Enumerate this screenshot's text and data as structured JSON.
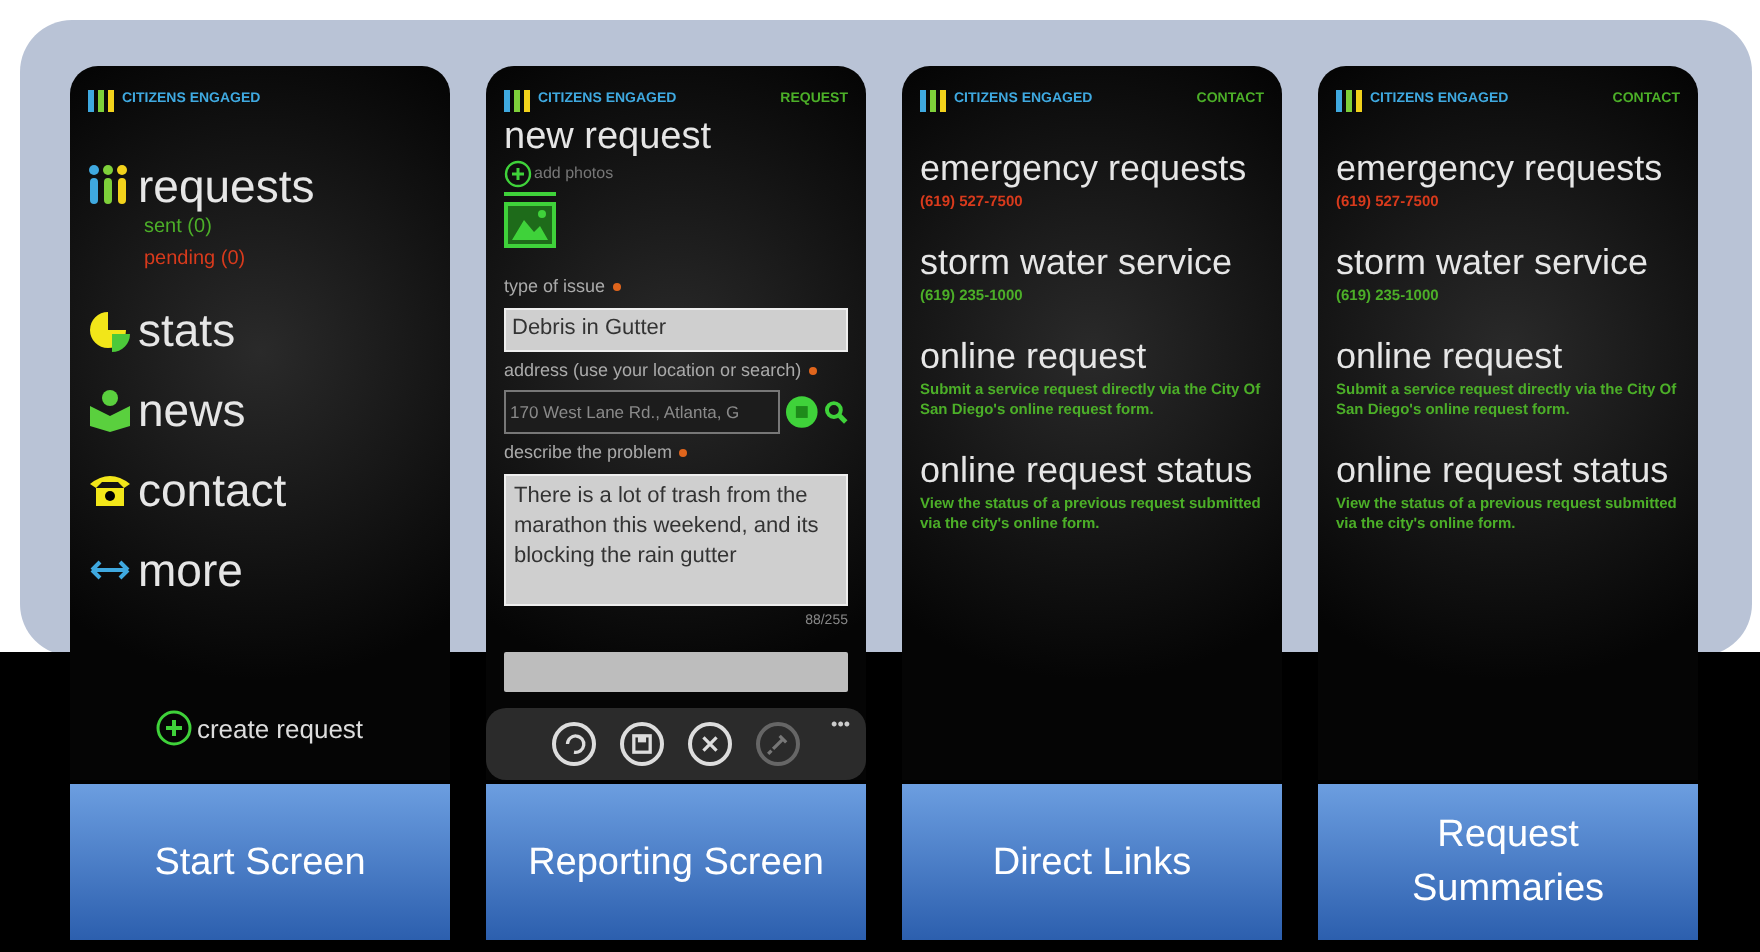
{
  "screens": [
    {
      "kind": "home",
      "brand": "CITIZENS ENGAGED",
      "caption": "Start Screen",
      "menu": [
        {
          "label": "requests",
          "sub": [
            {
              "label": "sent (0)",
              "color": "#4caf28"
            },
            {
              "label": "pending (0)",
              "color": "#d83a1c"
            }
          ]
        },
        {
          "label": "stats"
        },
        {
          "label": "news"
        },
        {
          "label": "contact"
        },
        {
          "label": "more"
        }
      ],
      "create": "create request"
    },
    {
      "kind": "form",
      "brand": "CITIZENS ENGAGED",
      "action": "REQUEST",
      "caption": "Reporting Screen",
      "title": "new request",
      "add_photos": "add photos",
      "fields": [
        {
          "kind": "text",
          "label": "type of issue",
          "required": true,
          "value": "Debris in Gutter"
        },
        {
          "kind": "location",
          "label": "address (use your location or search)",
          "required": true,
          "placeholder": "170 West Lane Rd., Atlanta, G"
        },
        {
          "kind": "area",
          "label": "describe the problem",
          "required": true,
          "value": "There is a lot of trash from the marathon this weekend, and its blocking the rain gutter",
          "counter": "88/255"
        }
      ],
      "more": "•••"
    },
    {
      "kind": "links",
      "brand": "CITIZENS ENGAGED",
      "action": "CONTACT",
      "caption": "Direct Links",
      "links": [
        {
          "title": "emergency requests",
          "detail": "(619) 527-7500",
          "color": "#d83a1c"
        },
        {
          "title": "storm water service",
          "detail": "(619) 235-1000",
          "color": "#4caf28"
        },
        {
          "title": "online request",
          "detail": "Submit a service request directly via the City Of San Diego's online request form.",
          "color": "#4caf28"
        },
        {
          "title": "online request status",
          "detail": "View the status of a previous request submitted via the city's online form.",
          "color": "#4caf28"
        }
      ]
    },
    {
      "kind": "links",
      "brand": "CITIZENS ENGAGED",
      "action": "CONTACT",
      "caption": "Request Summaries",
      "links": [
        {
          "title": "emergency requests",
          "detail": "(619) 527-7500",
          "color": "#d83a1c"
        },
        {
          "title": "storm water service",
          "detail": "(619) 235-1000",
          "color": "#4caf28"
        },
        {
          "title": "online request",
          "detail": "Submit a service request directly via the City Of San Diego's online request form.",
          "color": "#4caf28"
        },
        {
          "title": "online request status",
          "detail": "View the status of a previous request submitted via the city's online form.",
          "color": "#4caf28"
        }
      ]
    }
  ]
}
